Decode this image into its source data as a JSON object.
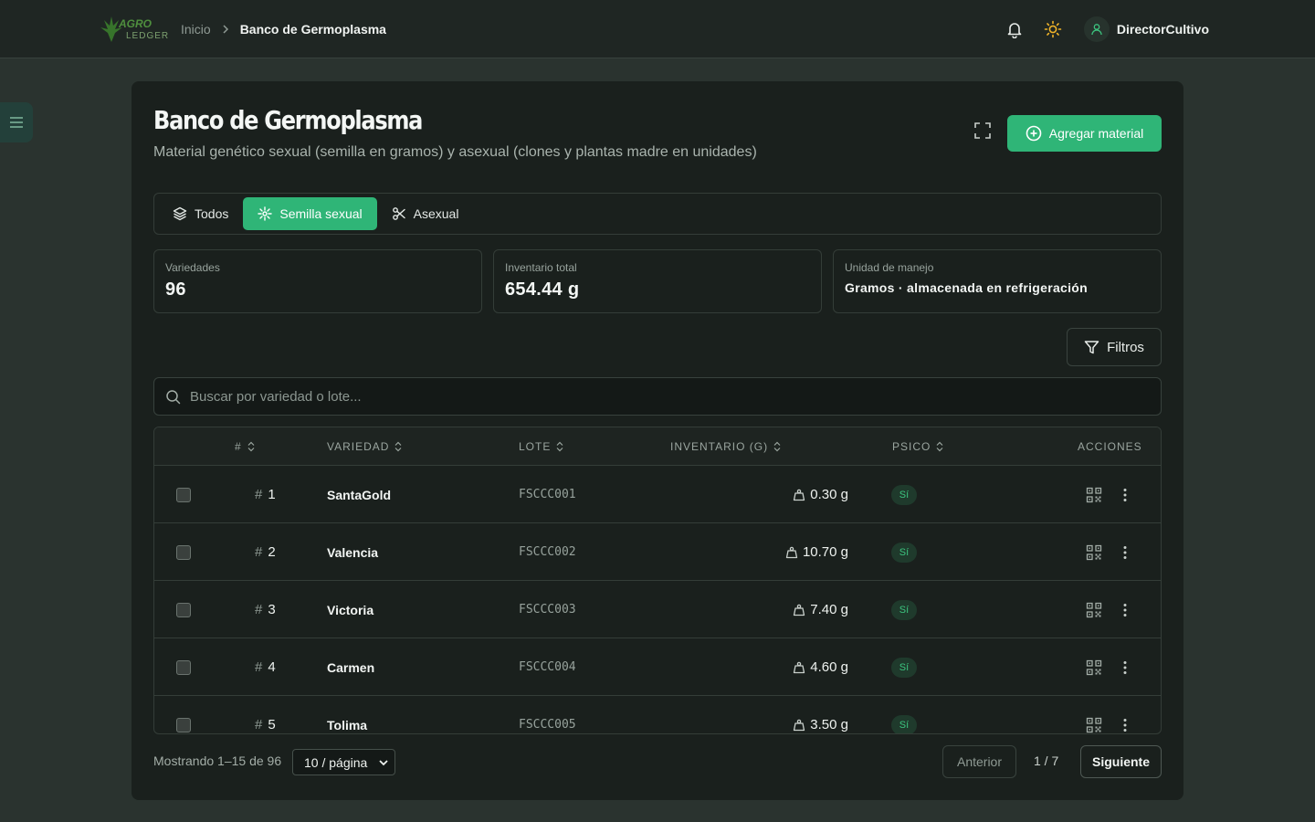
{
  "app": {
    "logo_text": "AGRO LEDGER"
  },
  "breadcrumb": {
    "home": "Inicio",
    "current": "Banco de Germoplasma"
  },
  "user": {
    "name": "DirectorCultivo"
  },
  "page": {
    "title": "Banco de Germoplasma",
    "subtitle": "Material genético sexual (semilla en gramos) y asexual (clones y plantas madre en unidades)",
    "add_button": "Agregar material"
  },
  "tabs": [
    {
      "label": "Todos",
      "icon": "layers-icon",
      "active": false
    },
    {
      "label": "Semilla sexual",
      "icon": "seed-icon",
      "active": true
    },
    {
      "label": "Asexual",
      "icon": "scissors-icon",
      "active": false
    }
  ],
  "stats": [
    {
      "label": "Variedades",
      "value": "96"
    },
    {
      "label": "Inventario total",
      "value": "654.44 g"
    },
    {
      "label": "Unidad de manejo",
      "value": "Gramos · almacenada en refrigeración"
    }
  ],
  "filters_button": "Filtros",
  "search": {
    "placeholder": "Buscar por variedad o lote..."
  },
  "table": {
    "columns": [
      "#",
      "VARIEDAD",
      "LOTE",
      "INVENTARIO (G)",
      "PSICO",
      "ACCIONES"
    ],
    "rows": [
      {
        "num": "1",
        "variety": "SantaGold",
        "lote": "FSCCC001",
        "inventory": "0.30 g",
        "psico": "Sí"
      },
      {
        "num": "2",
        "variety": "Valencia",
        "lote": "FSCCC002",
        "inventory": "10.70 g",
        "psico": "Sí"
      },
      {
        "num": "3",
        "variety": "Victoria",
        "lote": "FSCCC003",
        "inventory": "7.40 g",
        "psico": "Sí"
      },
      {
        "num": "4",
        "variety": "Carmen",
        "lote": "FSCCC004",
        "inventory": "4.60 g",
        "psico": "Sí"
      },
      {
        "num": "5",
        "variety": "Tolima",
        "lote": "FSCCC005",
        "inventory": "3.50 g",
        "psico": "Sí"
      }
    ]
  },
  "pagination": {
    "showing": "Mostrando 1–15 de 96",
    "per_page": "10 / página",
    "prev": "Anterior",
    "page_indicator": "1 / 7",
    "next": "Siguiente"
  },
  "colors": {
    "accent": "#2fb577",
    "background": "#2a332f",
    "card": "#1a201d"
  }
}
